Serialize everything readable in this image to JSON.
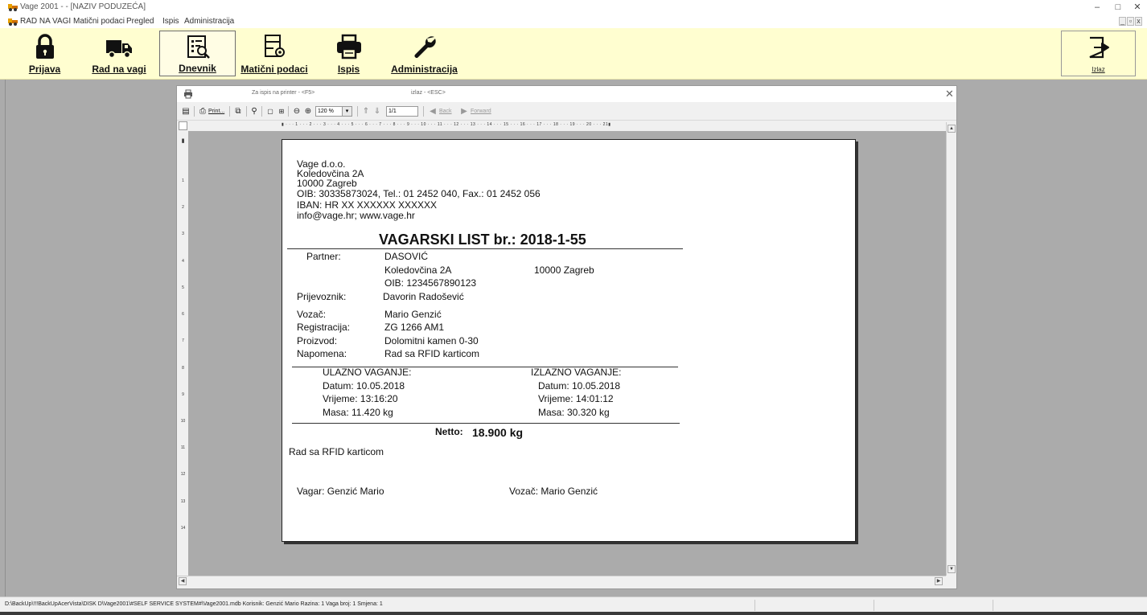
{
  "window": {
    "title": "Vage 2001 - - [NAZIV PODUZEĆA]",
    "controls": [
      "–",
      "□",
      "✕"
    ]
  },
  "menu": {
    "items": [
      "RAD NA VAGI",
      "Matični podaci",
      "Pregled",
      "Ispis",
      "Administracija"
    ],
    "mdi_controls": [
      "_",
      "▫",
      "x"
    ]
  },
  "toolbar": {
    "buttons": [
      {
        "label": "Prijava",
        "icon": "lock-icon"
      },
      {
        "label": "Rad na vagi",
        "icon": "truck-icon"
      },
      {
        "label": "Dnevnik",
        "icon": "journal-search-icon",
        "active": true
      },
      {
        "label": "Matični podaci",
        "icon": "data-settings-icon"
      },
      {
        "label": "Ispis",
        "icon": "printer-icon"
      },
      {
        "label": "Administracija",
        "icon": "wrench-icon"
      }
    ],
    "exit_label": "Izlaz"
  },
  "preview": {
    "hint_print": "Za ispis na printer - <F5>",
    "hint_exit": "izlaz - <ESC>",
    "print_label": "Print...",
    "zoom_value": "120 %",
    "page_value": "1/1",
    "back_label": "Back",
    "forward_label": "Forward",
    "ruler_h": "▮ · · · 1 · · · 2 · · · 3 · · · 4 · · · 5 · · · 6 · · · 7 · · · 8 · · · 9 · · · 10 · · · 11 · · · 12 · · · 13 · · · 14 · · · 15 · · · 16 · · · 17 · · · 18 · · · 19 · · · 20 · · · 21▮",
    "ruler_v": [
      "1",
      "2",
      "3",
      "4",
      "5",
      "6",
      "7",
      "8",
      "9",
      "10",
      "11",
      "12",
      "13",
      "14"
    ]
  },
  "report": {
    "company": {
      "name": "Vage d.o.o.",
      "street": "Koledovčina 2A",
      "city": "10000 Zagreb",
      "ids": "OIB: 30335873024, Tel.: 01 2452 040, Fax.: 01 2452 056",
      "iban": "IBAN: HR XX XXXXXX XXXXXX",
      "contact": "info@vage.hr;  www.vage.hr"
    },
    "heading": "VAGARSKI LIST br.: 2018-1-55",
    "partner_label": "Partner:",
    "partner_name": "DASOVIĆ",
    "partner_street": "Koledovčina 2A",
    "partner_city": "10000 Zagreb",
    "partner_oib": "OIB: 1234567890123",
    "carrier_label": "Prijevoznik:",
    "carrier_value": "Davorin Radošević",
    "driver_label": "Vozač:",
    "driver_value": "Mario Genzić",
    "reg_label": "Registracija:",
    "reg_value": "ZG 1266 AM1",
    "product_label": "Proizvod:",
    "product_value": "Dolomitni kamen 0-30",
    "note_label": "Napomena:",
    "note_value": "Rad sa RFID karticom",
    "in_title": "ULAZNO VAGANJE:",
    "in_date": "Datum:   10.05.2018",
    "in_time": "Vrijeme:  13:16:20",
    "in_mass": "Masa:    11.420  kg",
    "out_title": "IZLAZNO VAGANJE:",
    "out_date": "Datum:   10.05.2018",
    "out_time": "Vrijeme:  14:01:12",
    "out_mass": "Masa:    30.320  kg",
    "netto_label": "Netto:",
    "netto_value": "18.900  kg",
    "footer_note": "Rad sa RFID karticom",
    "sign_weigher": "Vagar:  Genzić Mario",
    "sign_driver": "Vozač:  Mario Genzić"
  },
  "status": {
    "text": "D:\\BackUp\\!!!BackUpAcerVista\\DISK D\\Vage2001\\#SELF SERVICE SYSTEM#\\Vage2001.mdb  Korisnik: Genzić Mario   Razina: 1   Vaga broj: 1    Smjena: 1"
  },
  "colors": {
    "toolbar_bg": "#fffed0",
    "workspace_bg": "#ababab"
  }
}
